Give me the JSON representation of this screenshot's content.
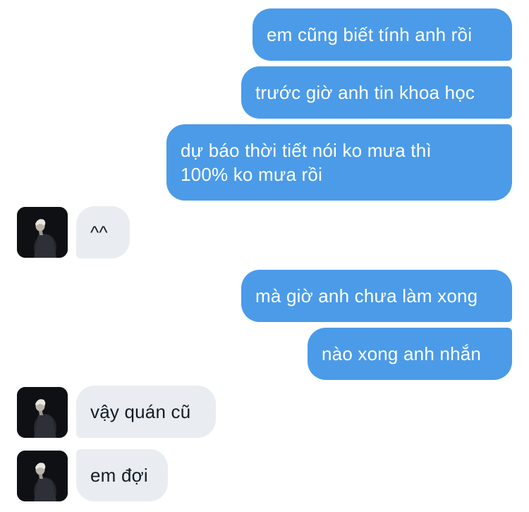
{
  "conversation": {
    "messages": [
      {
        "direction": "outgoing",
        "text": "em cũng biết tính anh rồi"
      },
      {
        "direction": "outgoing",
        "text": "trước giờ anh tin khoa học"
      },
      {
        "direction": "outgoing",
        "text": "dự báo thời tiết nói ko mưa thì 100% ko mưa rồi"
      },
      {
        "direction": "incoming",
        "text": "^^"
      },
      {
        "direction": "outgoing",
        "text": "mà giờ anh chưa làm xong"
      },
      {
        "direction": "outgoing",
        "text": "nào xong anh nhắn"
      },
      {
        "direction": "incoming",
        "text": "vậy quán cũ"
      },
      {
        "direction": "incoming",
        "text": "em đợi"
      }
    ]
  },
  "colors": {
    "outgoing_bubble": "#4b9be8",
    "outgoing_text": "#ffffff",
    "incoming_bubble": "#e9edf1",
    "incoming_text": "#141d26",
    "background": "#ffffff"
  },
  "icons": {
    "avatar": "contact-avatar-photo"
  }
}
